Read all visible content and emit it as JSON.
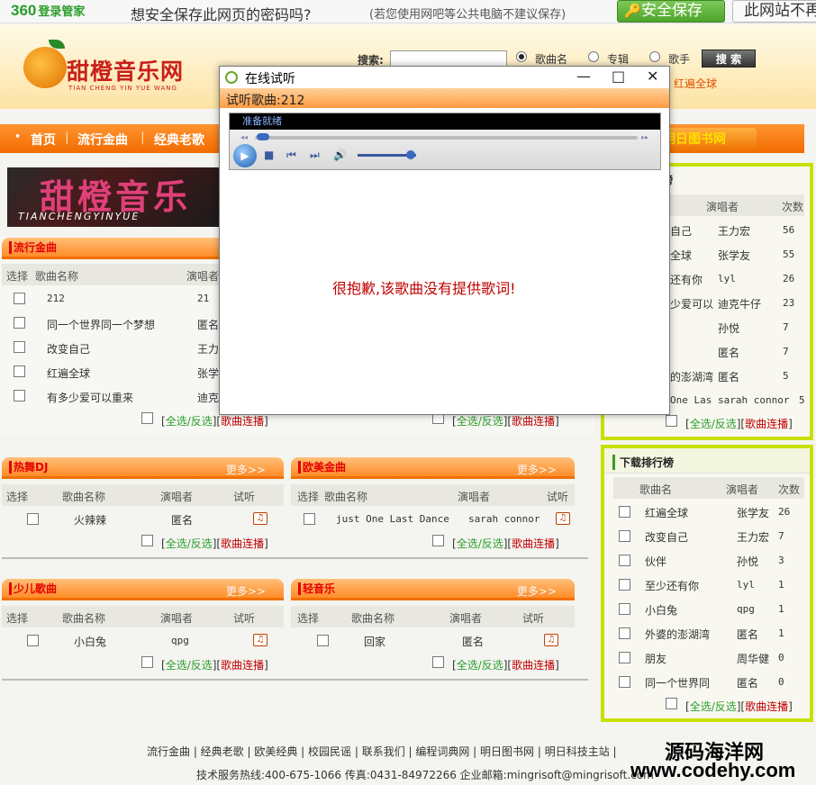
{
  "bar360": {
    "logo": "360",
    "logo_sub": "登录管家",
    "question": "想安全保存此网页的密码吗?",
    "hint": "(若您使用网吧等公共电脑不建议保存)",
    "save_label": "安全保存",
    "never_label": "此网站不再"
  },
  "header": {
    "logo_text": "甜橙音乐网",
    "logo_sub": "TIAN CHENG YIN YUE WANG",
    "search_label": "搜索:",
    "search_value": "",
    "radio_song": "歌曲名",
    "radio_album": "专辑",
    "radio_singer": "歌手",
    "search_button": "搜 索",
    "hot_text": "红遍全球"
  },
  "nav": {
    "items": [
      "首页",
      "流行金曲",
      "经典老歌"
    ],
    "right": "明日图书网"
  },
  "banner": {
    "title": "甜橙音乐",
    "sub": "TIANCHENGYINYUE"
  },
  "popular": {
    "title": "流行金曲",
    "col_select": "选择",
    "col_name": "歌曲名称",
    "col_singer": "演唱者",
    "rows": [
      {
        "name": "212",
        "singer": "21"
      },
      {
        "name": "同一个世界同一个梦想",
        "singer": "匿名"
      },
      {
        "name": "改变自己",
        "singer": "王力宏"
      },
      {
        "name": "红遍全球",
        "singer": "张学"
      },
      {
        "name": "有多少爱可以重来",
        "singer": "迪克"
      }
    ],
    "ops": {
      "open": "[",
      "all": "全选/反选",
      "mid": "][",
      "play": "歌曲连播",
      "close": "]"
    }
  },
  "popular_right_ops": {
    "open": "[",
    "all": "全选/反选",
    "mid": "][",
    "play": "歌曲连播",
    "close": "]"
  },
  "sections": [
    {
      "title": "热舞DJ",
      "more": "更多>>",
      "cols": [
        "选择",
        "歌曲名称",
        "演唱者",
        "试听"
      ],
      "row": {
        "name": "火辣辣",
        "singer": "匿名"
      }
    },
    {
      "title": "欧美金曲",
      "more": "更多>>",
      "cols": [
        "选择",
        "歌曲名称",
        "演唱者",
        "试听"
      ],
      "row": {
        "name": "just One Last Dance",
        "singer": "sarah connor"
      }
    },
    {
      "title": "少儿歌曲",
      "more": "更多>>",
      "cols": [
        "选择",
        "歌曲名称",
        "演唱者",
        "试听"
      ],
      "row": {
        "name": "小白兔",
        "singer": "qpg"
      }
    },
    {
      "title": "轻音乐",
      "more": "更多>>",
      "cols": [
        "选择",
        "歌曲名称",
        "演唱者",
        "试听"
      ],
      "row": {
        "name": "回家",
        "singer": "匿名"
      }
    }
  ],
  "section_ops": {
    "open": "[",
    "all": "全选/反选",
    "mid": "][",
    "play": "歌曲连播",
    "close": "]"
  },
  "right_top": {
    "title": "榜",
    "col_singer": "演唱者",
    "col_count": "次数",
    "rows": [
      {
        "name": "自己",
        "singer": "王力宏",
        "count": "56"
      },
      {
        "name": "全球",
        "singer": "张学友",
        "count": "55"
      },
      {
        "name": "还有你",
        "singer": "lyl",
        "count": "26"
      },
      {
        "name": "少爱可以",
        "singer": "迪克牛仔",
        "count": "23"
      },
      {
        "name": "",
        "singer": "孙悦",
        "count": "7"
      },
      {
        "name": "",
        "singer": "匿名",
        "count": "7"
      },
      {
        "name": "的澎湖湾",
        "singer": "匿名",
        "count": "5"
      },
      {
        "name": "One Las",
        "singer": "sarah connor",
        "count": "5"
      }
    ]
  },
  "download": {
    "title": "下载排行榜",
    "col_name": "歌曲名",
    "col_singer": "演唱者",
    "col_count": "次数",
    "rows": [
      {
        "name": "红遍全球",
        "singer": "张学友",
        "count": "26"
      },
      {
        "name": "改变自己",
        "singer": "王力宏",
        "count": "7"
      },
      {
        "name": "伙伴",
        "singer": "孙悦",
        "count": "3"
      },
      {
        "name": "至少还有你",
        "singer": "lyl",
        "count": "1"
      },
      {
        "name": "小白兔",
        "singer": "qpg",
        "count": "1"
      },
      {
        "name": "外婆的澎湖湾",
        "singer": "匿名",
        "count": "1"
      },
      {
        "name": "朋友",
        "singer": "周华健",
        "count": "0"
      },
      {
        "name": "同一个世界同",
        "singer": "匿名",
        "count": "0"
      }
    ]
  },
  "popup": {
    "title": "在线试听",
    "subtitle": "试听歌曲:212",
    "status": "准备就绪",
    "message": "很抱歉,该歌曲没有提供歌词!"
  },
  "footer": {
    "links": "流行金曲 | 经典老歌 | 欧美经典 | 校园民谣 | 联系我们 | 编程词典网 | 明日图书网 | 明日科技主站 |",
    "info": "技术服务热线:400-675-1066 传真:0431-84972266 企业邮箱:mingrisoft@mingrisoft.com"
  },
  "watermark": {
    "line1": "源码海洋网",
    "line2": "www.codehy.com"
  },
  "colors": {
    "accent": "#ff8c28",
    "green_border": "#c8e000",
    "red_link": "#c00000"
  }
}
